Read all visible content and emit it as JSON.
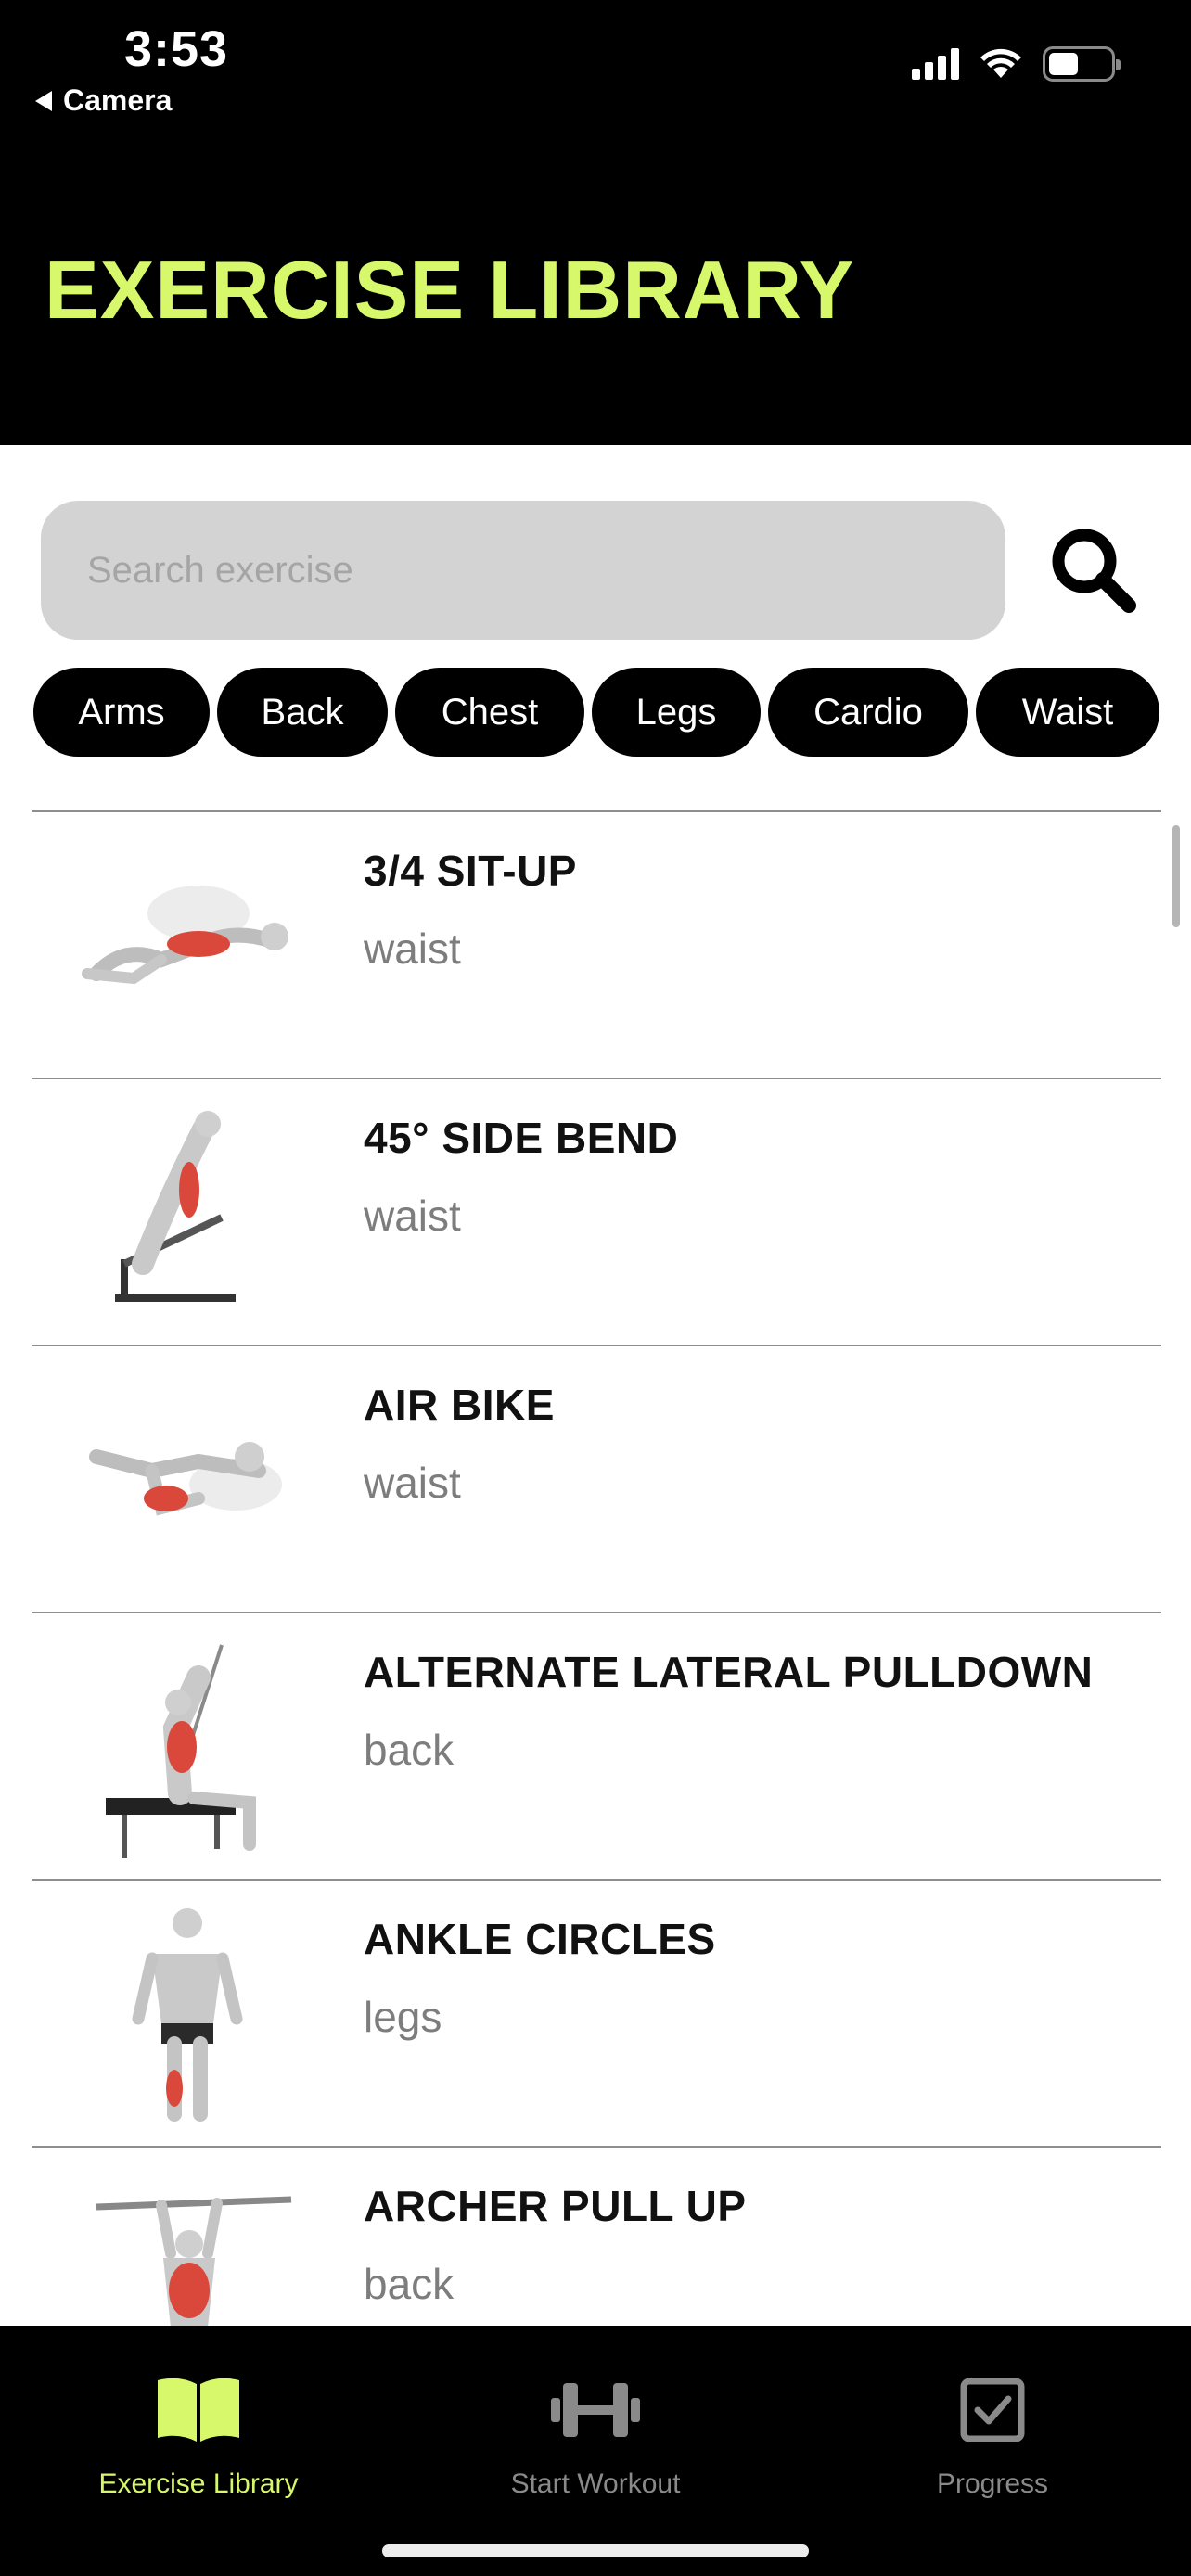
{
  "status_bar": {
    "time": "3:53",
    "back_app": "Camera"
  },
  "header": {
    "title": "EXERCISE LIBRARY"
  },
  "search": {
    "placeholder": "Search exercise",
    "value": ""
  },
  "categories": [
    "Arms",
    "Back",
    "Chest",
    "Legs",
    "Cardio",
    "Waist"
  ],
  "exercises": [
    {
      "name": "3/4 SIT-UP",
      "body_part": "waist"
    },
    {
      "name": "45° SIDE BEND",
      "body_part": "waist"
    },
    {
      "name": "AIR BIKE",
      "body_part": "waist"
    },
    {
      "name": "ALTERNATE LATERAL PULLDOWN",
      "body_part": "back"
    },
    {
      "name": "ANKLE CIRCLES",
      "body_part": "legs"
    },
    {
      "name": "ARCHER PULL UP",
      "body_part": "back"
    }
  ],
  "tabs": [
    {
      "label": "Exercise Library",
      "icon": "book-icon",
      "active": true
    },
    {
      "label": "Start Workout",
      "icon": "dumbbell-icon",
      "active": false
    },
    {
      "label": "Progress",
      "icon": "checkbox-icon",
      "active": false
    }
  ],
  "colors": {
    "accent": "#d6f86a",
    "highlight_muscle": "#d9483b",
    "inactive_tab": "#8a8a8a"
  }
}
